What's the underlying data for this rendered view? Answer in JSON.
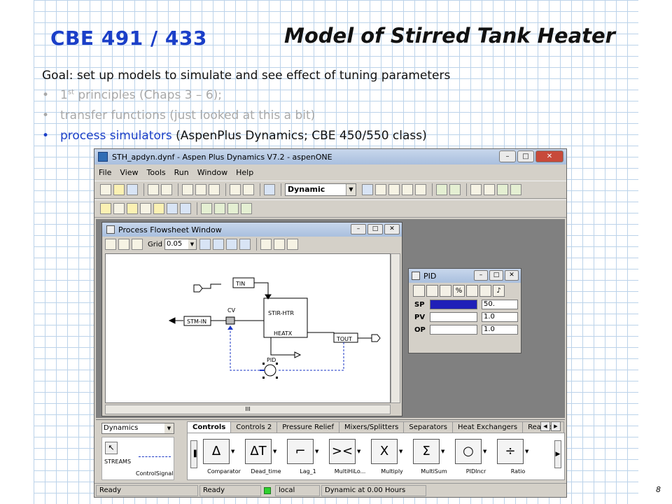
{
  "slide": {
    "course": "CBE 491 / 433",
    "title": "Model of Stirred Tank Heater",
    "goal": "Goal: set up models to simulate and see effect of tuning parameters",
    "bullets": [
      {
        "text": "1",
        "sup": "st",
        "rest": " principles (Chaps 3 – 6);",
        "state": "dimmed"
      },
      {
        "text": "transfer functions (just looked at this a bit)",
        "state": "dimmed"
      },
      {
        "highlight": "process simulators",
        "rest": " (AspenPlus Dynamics; CBE 450/550 class)",
        "state": "active"
      }
    ],
    "bullet_glyph": "•",
    "page_number": "8",
    "colors": {
      "title_blue": "#1b3fc8",
      "dimmed": "#a9a9a9",
      "grid": "#bcd3ea"
    }
  },
  "app": {
    "window_title": "STH_apdyn.dynf - Aspen Plus Dynamics V7.2 - aspenONE",
    "menu": [
      "File",
      "View",
      "Tools",
      "Run",
      "Window",
      "Help"
    ],
    "run_mode": "Dynamic",
    "window_buttons": {
      "minimize": "–",
      "maximize": "□",
      "close": "✕"
    }
  },
  "flowsheet": {
    "title": "Process Flowsheet Window",
    "grid_label": "Grid",
    "grid_value": "0.05",
    "blocks": {
      "tin": "TIN",
      "stir_htr": "STIR-HTR",
      "heatx": "HEATX",
      "stm_in": "STM-IN",
      "cv": "CV",
      "tout": "TOUT",
      "pid": "PID"
    }
  },
  "pid_faceplate": {
    "title": "PID",
    "rows": [
      {
        "label": "SP",
        "value": "50."
      },
      {
        "label": "PV",
        "value": "1.0"
      },
      {
        "label": "OP",
        "value": "1.0"
      }
    ]
  },
  "palette": {
    "library": "Dynamics",
    "streams_label": "STREAMS",
    "control_signal": "ControlSignal",
    "tabs": [
      "Controls",
      "Controls 2",
      "Pressure Relief",
      "Mixers/Splitters",
      "Separators",
      "Heat Exchangers",
      "Reactors"
    ],
    "models": [
      {
        "glyph": "Δ",
        "label": "Comparator"
      },
      {
        "glyph": "ΔT",
        "label": "Dead_time"
      },
      {
        "glyph": "⌐",
        "label": "Lag_1"
      },
      {
        "glyph": "><",
        "label": "MultiHiLo..."
      },
      {
        "glyph": "X",
        "label": "Multiply"
      },
      {
        "glyph": "Σ",
        "label": "MultiSum"
      },
      {
        "glyph": "○",
        "label": "PIDIncr"
      },
      {
        "glyph": "÷",
        "label": "Ratio"
      }
    ]
  },
  "status": {
    "left": "Ready",
    "right": "Ready",
    "mode": "local",
    "time": "Dynamic at 0.00 Hours"
  }
}
